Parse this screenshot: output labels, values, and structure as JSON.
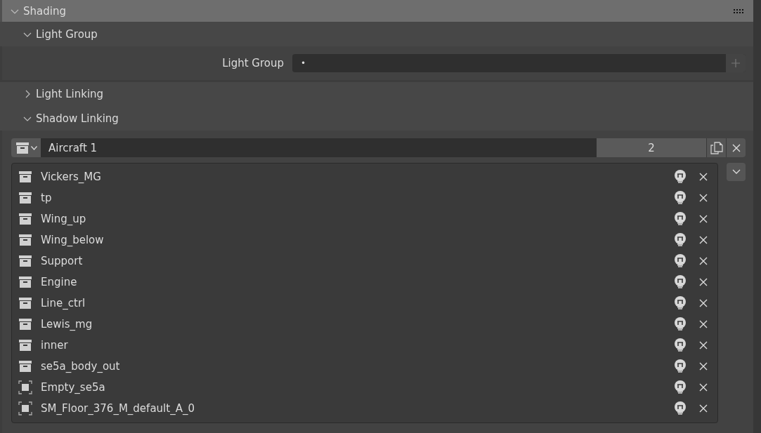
{
  "panel": {
    "title": "Shading",
    "expanded": true
  },
  "light_group": {
    "title": "Light Group",
    "expanded": true,
    "field_label": "Light Group",
    "field_value": "•"
  },
  "light_linking": {
    "title": "Light Linking",
    "expanded": false
  },
  "shadow_linking": {
    "title": "Shadow Linking",
    "expanded": true,
    "collection": {
      "name": "Aircraft 1",
      "users": "2"
    },
    "items": [
      {
        "name": "Vickers_MG",
        "kind": "collection"
      },
      {
        "name": "tp",
        "kind": "collection"
      },
      {
        "name": "Wing_up",
        "kind": "collection"
      },
      {
        "name": "Wing_below",
        "kind": "collection"
      },
      {
        "name": "Support",
        "kind": "collection"
      },
      {
        "name": "Engine",
        "kind": "collection"
      },
      {
        "name": "Line_ctrl",
        "kind": "collection"
      },
      {
        "name": "Lewis_mg",
        "kind": "collection"
      },
      {
        "name": "inner",
        "kind": "collection"
      },
      {
        "name": "se5a_body_out",
        "kind": "collection"
      },
      {
        "name": "Empty_se5a",
        "kind": "object"
      },
      {
        "name": "SM_Floor_376_M_default_A_0",
        "kind": "object"
      }
    ]
  }
}
